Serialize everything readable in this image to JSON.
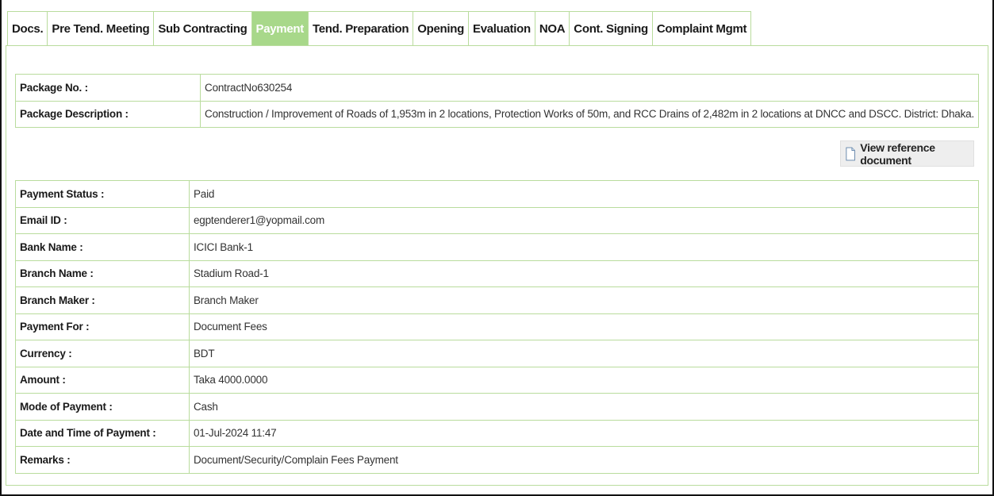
{
  "tabs": [
    {
      "label": "Docs.",
      "active": false
    },
    {
      "label": "Pre Tend. Meeting",
      "active": false
    },
    {
      "label": "Sub Contracting",
      "active": false
    },
    {
      "label": "Payment",
      "active": true
    },
    {
      "label": "Tend. Preparation",
      "active": false
    },
    {
      "label": "Opening",
      "active": false
    },
    {
      "label": "Evaluation",
      "active": false
    },
    {
      "label": "NOA",
      "active": false
    },
    {
      "label": "Cont. Signing",
      "active": false
    },
    {
      "label": "Complaint Mgmt",
      "active": false
    }
  ],
  "package": {
    "no_label": "Package No. :",
    "no_value": "ContractNo630254",
    "desc_label": "Package Description :",
    "desc_value": "Construction / Improvement of Roads of 1,953m in 2 locations, Protection Works of 50m, and RCC Drains of 2,482m in 2 locations at DNCC and DSCC. District: Dhaka."
  },
  "reference_button": {
    "label": "View reference document",
    "icon": "document-icon"
  },
  "payment": [
    {
      "label": "Payment Status :",
      "value": "Paid"
    },
    {
      "label": "Email ID :",
      "value": "egptenderer1@yopmail.com"
    },
    {
      "label": "Bank Name :",
      "value": "ICICI Bank-1"
    },
    {
      "label": "Branch Name :",
      "value": "Stadium Road-1"
    },
    {
      "label": "Branch Maker :",
      "value": "Branch Maker"
    },
    {
      "label": "Payment For :",
      "value": "Document Fees"
    },
    {
      "label": "Currency :",
      "value": "BDT"
    },
    {
      "label": "Amount :",
      "value": "Taka 4000.0000"
    },
    {
      "label": "Mode of Payment :",
      "value": "Cash"
    },
    {
      "label": "Date and Time of Payment :",
      "value": "01-Jul-2024 11:47"
    },
    {
      "label": "Remarks :",
      "value": "Document/Security/Complain Fees Payment"
    }
  ],
  "colors": {
    "border": "#b9dc9d",
    "active_tab": "#a8d88a"
  }
}
